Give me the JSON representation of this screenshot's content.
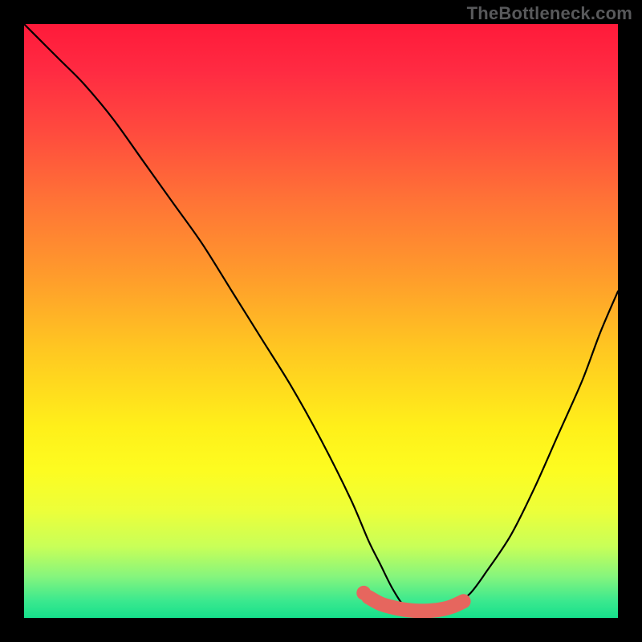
{
  "watermark": "TheBottleneck.com",
  "plot": {
    "inner_x": 30,
    "inner_y": 30,
    "inner_w": 740,
    "inner_h": 740
  },
  "gradient": {
    "stops": [
      {
        "offset": 0.0,
        "color": "#ff1a3a"
      },
      {
        "offset": 0.08,
        "color": "#ff2b42"
      },
      {
        "offset": 0.18,
        "color": "#ff4a3e"
      },
      {
        "offset": 0.3,
        "color": "#ff7436"
      },
      {
        "offset": 0.42,
        "color": "#ff9a2c"
      },
      {
        "offset": 0.55,
        "color": "#ffc821"
      },
      {
        "offset": 0.68,
        "color": "#fff01a"
      },
      {
        "offset": 0.75,
        "color": "#fdfc20"
      },
      {
        "offset": 0.82,
        "color": "#ecff3a"
      },
      {
        "offset": 0.88,
        "color": "#c8ff58"
      },
      {
        "offset": 0.93,
        "color": "#86f57d"
      },
      {
        "offset": 0.97,
        "color": "#3de98e"
      },
      {
        "offset": 1.0,
        "color": "#16e08c"
      }
    ]
  },
  "highlight_band": {
    "color": "#e6665e",
    "radius": 9,
    "dot_r": 9
  },
  "chart_data": {
    "type": "line",
    "title": "",
    "xlabel": "",
    "ylabel": "",
    "xlim": [
      0,
      100
    ],
    "ylim": [
      0,
      100
    ],
    "series": [
      {
        "name": "bottleneck-curve",
        "x": [
          0,
          3,
          6,
          10,
          15,
          20,
          25,
          30,
          35,
          40,
          45,
          50,
          55,
          58,
          60,
          62,
          64,
          66,
          68,
          70,
          72,
          75,
          78,
          82,
          86,
          90,
          94,
          97,
          100
        ],
        "y": [
          100,
          97,
          94,
          90,
          84,
          77,
          70,
          63,
          55,
          47,
          39,
          30,
          20,
          13,
          9,
          5,
          2,
          1,
          1,
          1,
          2,
          4,
          8,
          14,
          22,
          31,
          40,
          48,
          55
        ]
      }
    ],
    "highlight_segment": {
      "name": "optimal-range",
      "x": [
        58,
        60,
        62,
        64,
        66,
        68,
        70,
        72,
        74
      ],
      "y": [
        3.5,
        2.4,
        1.8,
        1.4,
        1.2,
        1.2,
        1.4,
        1.9,
        2.8
      ]
    },
    "highlight_dot": {
      "x": 57.2,
      "y": 4.2
    }
  }
}
